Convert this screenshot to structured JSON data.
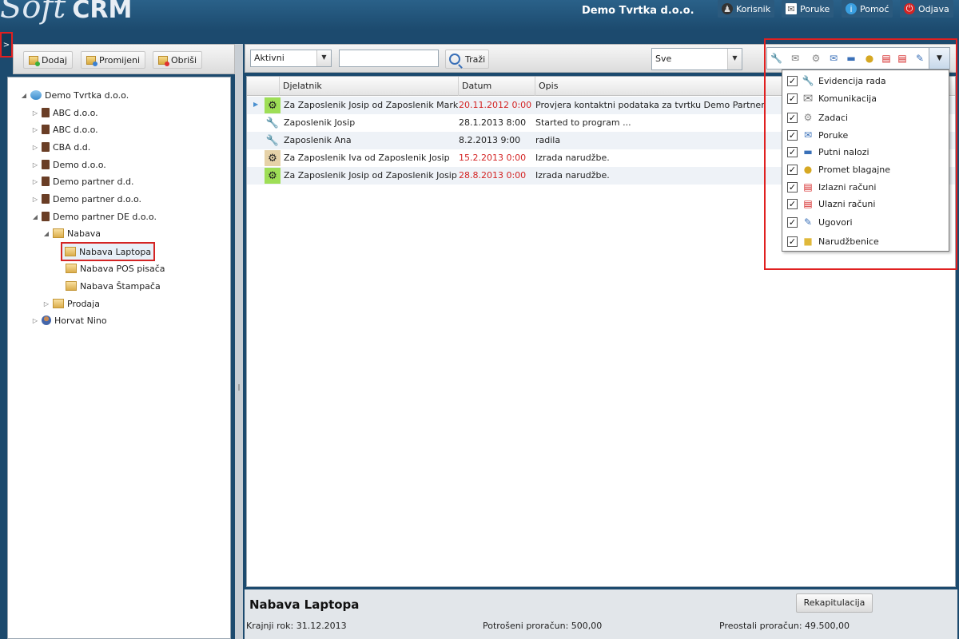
{
  "header": {
    "logo_soft": "Soft",
    "logo_crm": "CRM",
    "company": "Demo Tvrtka d.o.o.",
    "buttons": [
      {
        "label": "Korisnik",
        "icon": "user-icon"
      },
      {
        "label": "Poruke",
        "icon": "envelope-icon"
      },
      {
        "label": "Pomoć",
        "icon": "info-icon"
      },
      {
        "label": "Odjava",
        "icon": "power-icon"
      }
    ]
  },
  "collapse_tab": ">",
  "left_toolbar": {
    "add_label": "Dodaj",
    "edit_label": "Promijeni",
    "delete_label": "Obriši"
  },
  "tree": {
    "root": "Demo Tvrtka d.o.o.",
    "nodes": [
      {
        "label": "ABC d.o.o."
      },
      {
        "label": "ABC d.o.o."
      },
      {
        "label": "CBA d.d."
      },
      {
        "label": "Demo d.o.o."
      },
      {
        "label": "Demo partner d.d."
      },
      {
        "label": "Demo partner d.o.o."
      },
      {
        "label": "Demo partner DE d.o.o."
      },
      {
        "label": "Nabava"
      },
      {
        "label": "Nabava Laptopa"
      },
      {
        "label": "Nabava POS pisača"
      },
      {
        "label": "Nabava Štampača"
      },
      {
        "label": "Prodaja"
      },
      {
        "label": "Horvat Nino"
      }
    ]
  },
  "filter": {
    "status_value": "Aktivni",
    "search_value": "",
    "search_label": "Traži",
    "type_value": "Sve"
  },
  "grid": {
    "columns": [
      "Djelatnik",
      "Datum",
      "Opis"
    ],
    "rows": [
      {
        "icon": "gear-icon",
        "employee": "Za Zaposlenik Josip od Zaposlenik Marko",
        "date": "20.11.2012 0:00",
        "desc": "Provjera kontaktni podataka za tvrtku Demo Partner DE"
      },
      {
        "icon": "wrench-icon",
        "employee": "Zaposlenik Josip",
        "date": "28.1.2013 8:00",
        "desc": "Started to program ..."
      },
      {
        "icon": "wrench-icon",
        "employee": "Zaposlenik Ana",
        "date": "8.2.2013 9:00",
        "desc": "radila"
      },
      {
        "icon": "gear-icon",
        "employee": "Za Zaposlenik Iva od Zaposlenik Josip",
        "date": "15.2.2013 0:00",
        "desc": "Izrada narudžbe."
      },
      {
        "icon": "gear-icon",
        "employee": "Za Zaposlenik Josip od Zaposlenik Josip",
        "date": "28.8.2013 0:00",
        "desc": "Izrada narudžbe."
      }
    ]
  },
  "type_filter_popup": {
    "items": [
      {
        "label": "Evidencija rada",
        "checked": true,
        "icon": "wrench-icon"
      },
      {
        "label": "Komunikacija",
        "checked": true,
        "icon": "envelope-icon"
      },
      {
        "label": "Zadaci",
        "checked": true,
        "icon": "gear-icon"
      },
      {
        "label": "Poruke",
        "checked": true,
        "icon": "mail-icon"
      },
      {
        "label": "Putni nalozi",
        "checked": true,
        "icon": "car-icon"
      },
      {
        "label": "Promet blagajne",
        "checked": true,
        "icon": "coins-icon"
      },
      {
        "label": "Izlazni računi",
        "checked": true,
        "icon": "invoice-out-icon"
      },
      {
        "label": "Ulazni računi",
        "checked": true,
        "icon": "invoice-in-icon"
      },
      {
        "label": "Ugovori",
        "checked": true,
        "icon": "contract-icon"
      },
      {
        "label": "Narudžbenice",
        "checked": true,
        "icon": "order-icon"
      }
    ]
  },
  "info": {
    "title": "Nabava Laptopa",
    "button_label": "Rekapitulacija",
    "deadline": "Krajnji rok: 31.12.2013",
    "spent": "Potrošeni proračun: 500,00",
    "remaining": "Preostali proračun: 49.500,00"
  },
  "colors": {
    "header_bg": "#1c4a6e",
    "overdue_date": "#d42424",
    "highlight_frame": "#e02020"
  }
}
